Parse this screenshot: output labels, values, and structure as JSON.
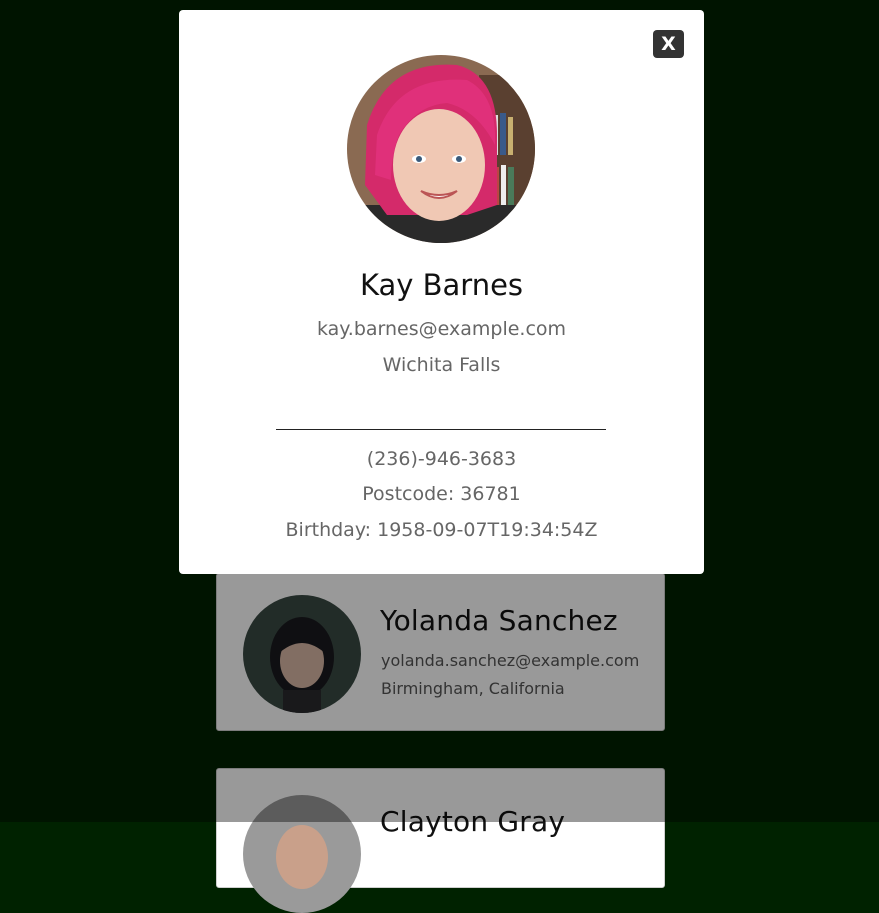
{
  "cards": [
    {
      "name": "Yolanda Sanchez",
      "email": "yolanda.sanchez@example.com",
      "location": "Birmingham, California"
    },
    {
      "name": "Clayton Gray"
    }
  ],
  "modal": {
    "close_label": "X",
    "name": "Kay Barnes",
    "email": "kay.barnes@example.com",
    "city": "Wichita Falls",
    "phone": "(236)-946-3683",
    "postcode": "Postcode: 36781",
    "birthday": "Birthday: 1958-09-07T19:34:54Z"
  },
  "colors": {
    "background": "#002200",
    "overlay": "rgba(0,0,0,0.4)",
    "close_button": "#333333"
  }
}
